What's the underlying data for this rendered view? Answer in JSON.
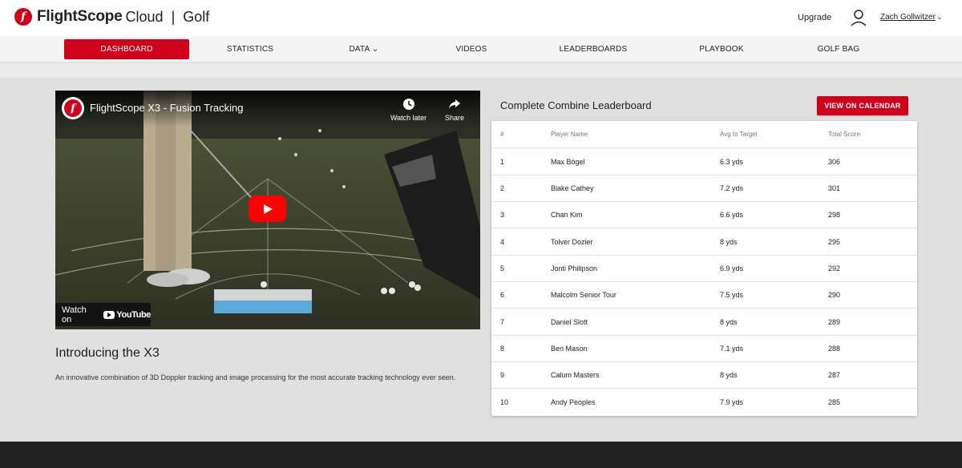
{
  "brand": {
    "name": "FlightScope",
    "product": "Cloud",
    "separator": "|",
    "section": "Golf"
  },
  "header": {
    "upgrade": "Upgrade",
    "user_name": "Zach Gollwitzer",
    "user_chevron": "⌄"
  },
  "nav": {
    "items": [
      {
        "label": "DASHBOARD"
      },
      {
        "label": "STATISTICS"
      },
      {
        "label": "DATA ⌄"
      },
      {
        "label": "VIDEOS"
      },
      {
        "label": "LEADERBOARDS"
      },
      {
        "label": "PLAYBOOK"
      },
      {
        "label": "GOLF BAG"
      }
    ],
    "active": "DASHBOARD"
  },
  "video": {
    "title": "FlightScope X3 - Fusion Tracking",
    "watch_later": "Watch later",
    "share": "Share",
    "watch_on": "Watch on",
    "youtube": "YouTube"
  },
  "intro": {
    "title": "Introducing the X3",
    "description": "An innovative combination of 3D Doppler tracking and image processing for the most accurate tracking technology ever seen."
  },
  "leaderboard": {
    "title": "Complete Combine Leaderboard",
    "button": "VIEW ON CALENDAR",
    "columns": [
      "#",
      "Player Name",
      "Avg to Target",
      "Total Score"
    ],
    "rows": [
      {
        "rank": "1",
        "name": "Max Bögel",
        "avg": "6.3 yds",
        "score": "306"
      },
      {
        "rank": "2",
        "name": "Blake Cathey",
        "avg": "7.2 yds",
        "score": "301"
      },
      {
        "rank": "3",
        "name": "Chan Kim",
        "avg": "6.6 yds",
        "score": "298"
      },
      {
        "rank": "4",
        "name": "Tolver Dozier",
        "avg": "8 yds",
        "score": "295"
      },
      {
        "rank": "5",
        "name": "Jonti Philipson",
        "avg": "6.9 yds",
        "score": "292"
      },
      {
        "rank": "6",
        "name": "Malcolm Senior Tour",
        "avg": "7.5 yds",
        "score": "290"
      },
      {
        "rank": "7",
        "name": "Daniel Slott",
        "avg": "8 yds",
        "score": "289"
      },
      {
        "rank": "8",
        "name": "Ben Mason",
        "avg": "7.1 yds",
        "score": "288"
      },
      {
        "rank": "9",
        "name": "Calum Masters",
        "avg": "8 yds",
        "score": "287"
      },
      {
        "rank": "10",
        "name": "Andy Peoples",
        "avg": "7.9 yds",
        "score": "285"
      }
    ]
  },
  "colors": {
    "accent": "#d0021b",
    "youtube_red": "#ff0000",
    "footer": "#222222"
  },
  "icons": [
    "flightscope-logo-icon",
    "user-icon",
    "chevron-down-icon",
    "clock-icon",
    "share-icon",
    "play-icon",
    "youtube-logo-icon"
  ]
}
